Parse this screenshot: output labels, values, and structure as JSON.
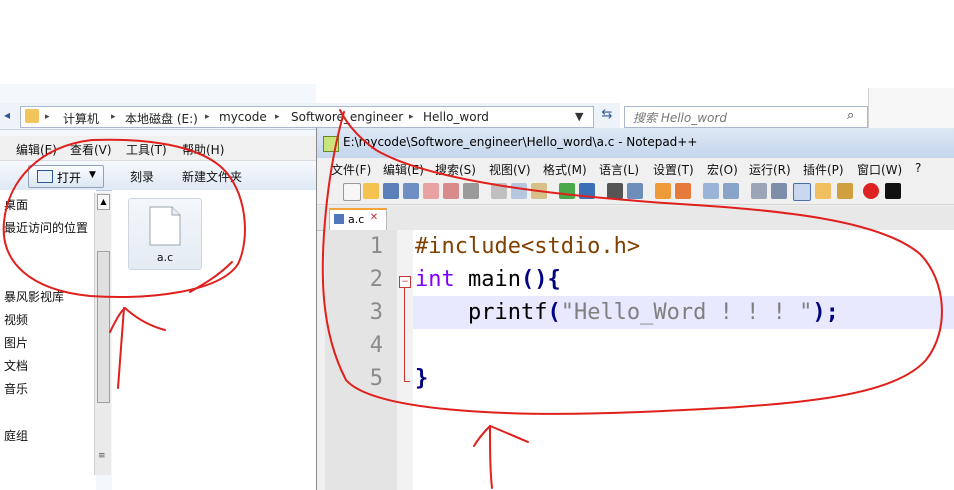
{
  "explorer": {
    "breadcrumb": [
      "计算机",
      "本地磁盘 (E:)",
      "mycode",
      "Softwore_engineer",
      "Hello_word"
    ],
    "search_placeholder": "搜索 Hello_word",
    "menu": [
      "编辑(E)",
      "查看(V)",
      "工具(T)",
      "帮助(H)"
    ],
    "toolbar": {
      "open_label": "打开",
      "burn_label": "刻录",
      "new_folder_label": "新建文件夹"
    },
    "nav_items": [
      "桌面",
      "最近访问的位置",
      "暴风影视库",
      "视频",
      "图片",
      "文档",
      "音乐",
      "庭组"
    ],
    "file": {
      "name": "a.c"
    }
  },
  "notepad": {
    "title": "E:\\mycode\\Softwore_engineer\\Hello_word\\a.c - Notepad++",
    "menu": [
      "文件(F)",
      "编辑(E)",
      "搜索(S)",
      "视图(V)",
      "格式(M)",
      "语言(L)",
      "设置(T)",
      "宏(O)",
      "运行(R)",
      "插件(P)",
      "窗口(W)",
      "?"
    ],
    "tab_label": "a.c",
    "line_numbers": [
      "1",
      "2",
      "3",
      "4",
      "5"
    ],
    "code": {
      "l1": "#include<stdio.h>",
      "l2_kw": "int",
      "l2_fn": " main",
      "l2_br": "(){",
      "l3_fn": "    printf",
      "l3_br1": "(",
      "l3_str": "\"Hello_Word ! ! ! \"",
      "l3_br2": ");",
      "l5_br": "}"
    }
  },
  "colors": {
    "annotation": "#e0201c",
    "keyword": "#8000ff",
    "string": "#808080",
    "preprocessor": "#804000"
  }
}
